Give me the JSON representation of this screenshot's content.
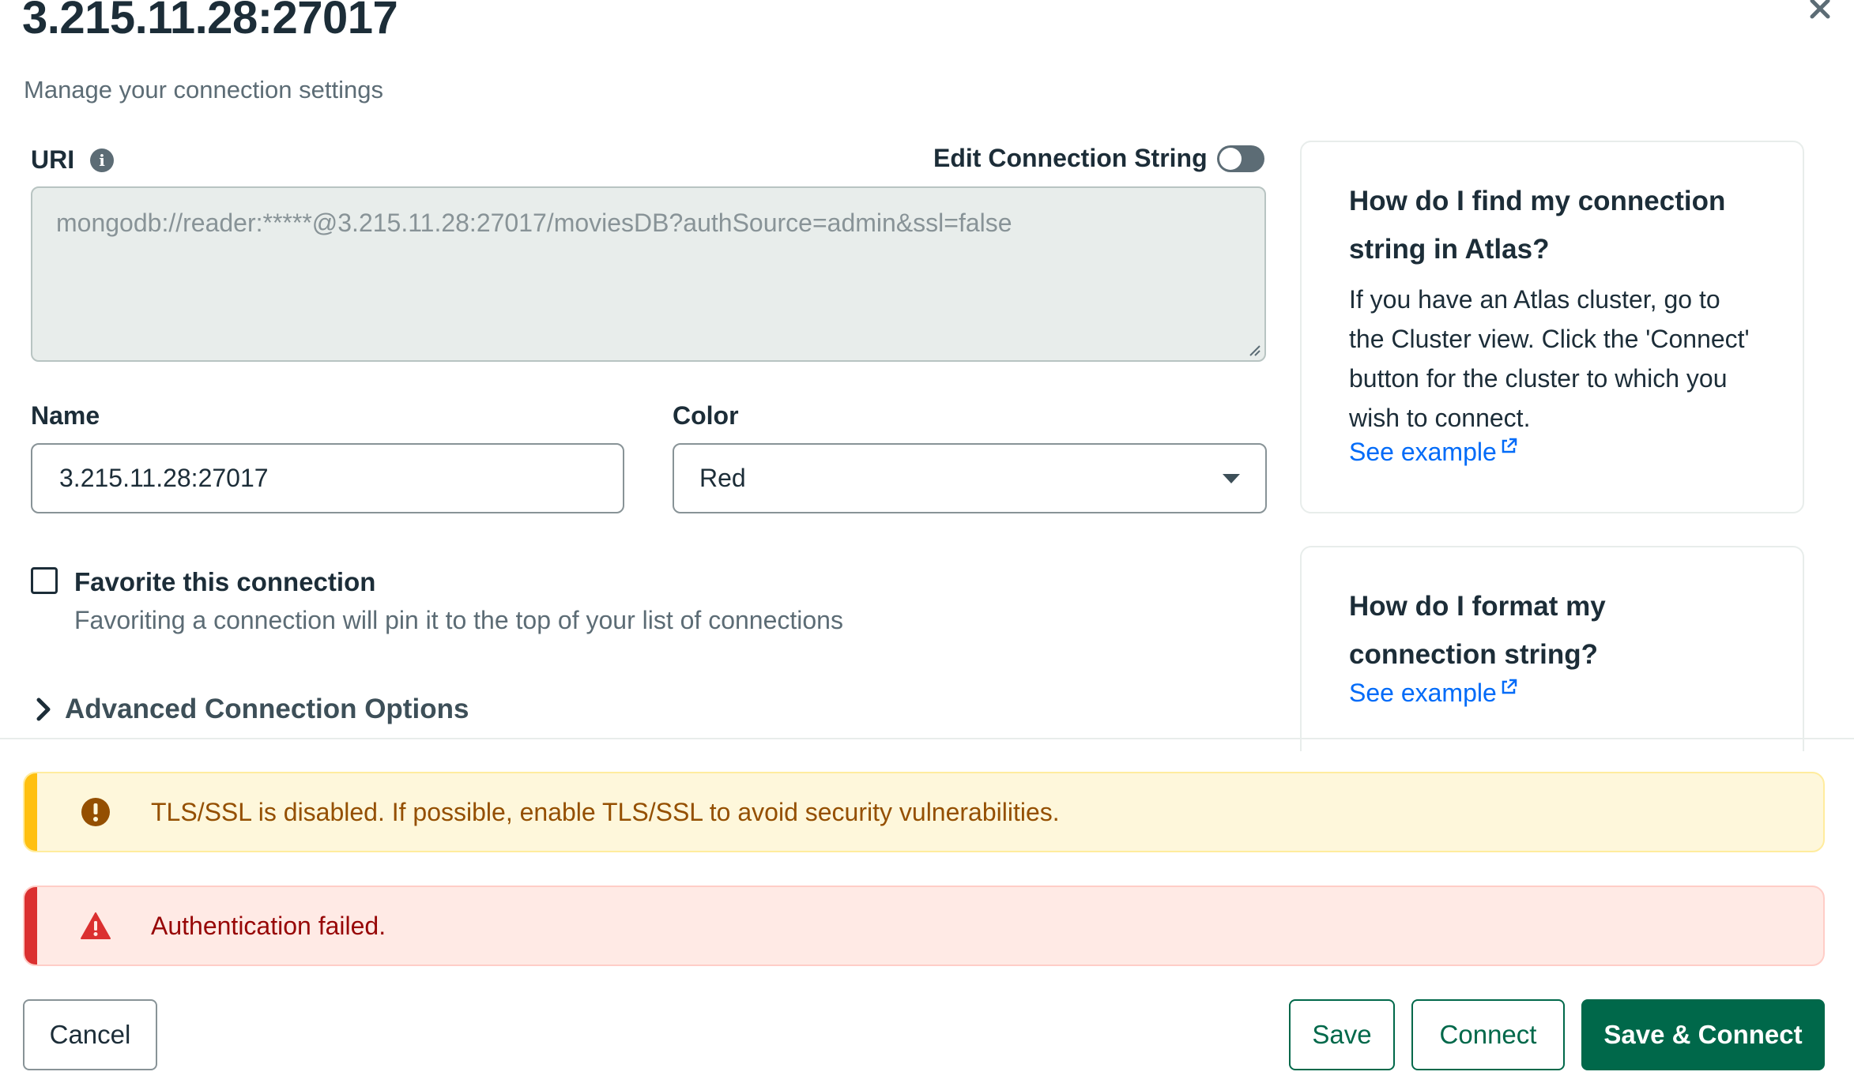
{
  "header": {
    "title": "3.215.11.28:27017",
    "subtitle": "Manage your connection settings"
  },
  "uri": {
    "label": "URI",
    "edit_toggle_label": "Edit Connection String",
    "edit_toggle_on": false,
    "value": "mongodb://reader:*****@3.215.11.28:27017/moviesDB?authSource=admin&ssl=false"
  },
  "name_field": {
    "label": "Name",
    "value": "3.215.11.28:27017"
  },
  "color_field": {
    "label": "Color",
    "selected": "Red"
  },
  "favorite": {
    "label": "Favorite this connection",
    "description": "Favoriting a connection will pin it to the top of your list of connections",
    "checked": false
  },
  "advanced": {
    "label": "Advanced Connection Options"
  },
  "help_cards": [
    {
      "title": "How do I find my connection string in Atlas?",
      "body": "If you have an Atlas cluster, go to the Cluster view. Click the 'Connect' button for the cluster to which you wish to connect.",
      "link": "See example"
    },
    {
      "title": "How do I format my connection string?",
      "link": "See example"
    }
  ],
  "banners": {
    "warning": "TLS/SSL is disabled. If possible, enable TLS/SSL to avoid security vulnerabilities.",
    "error": "Authentication failed."
  },
  "footer": {
    "cancel": "Cancel",
    "save": "Save",
    "connect": "Connect",
    "save_connect": "Save & Connect"
  },
  "colors": {
    "primary_green": "#00684a",
    "link_blue": "#016bf8",
    "warning_stripe": "#ffc010",
    "error_stripe": "#db3030"
  },
  "icons": {
    "close": "close-icon",
    "info": "info-icon",
    "chevron": "chevron-right-icon",
    "external": "external-link-icon",
    "warning": "warning-circle-icon",
    "error": "warning-triangle-icon"
  }
}
